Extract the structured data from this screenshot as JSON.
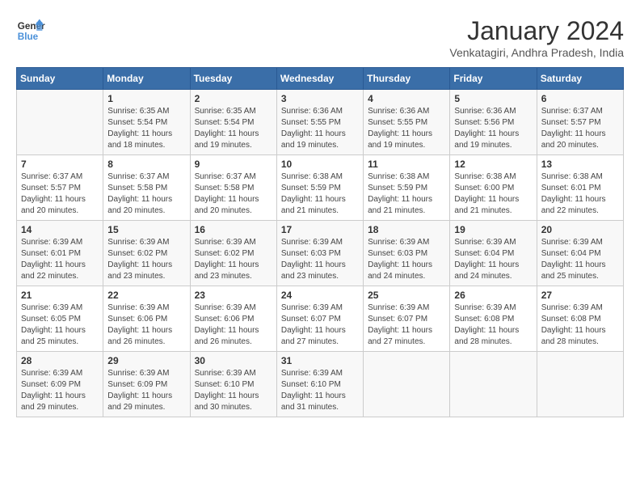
{
  "logo": {
    "line1": "General",
    "line2": "Blue"
  },
  "title": "January 2024",
  "subtitle": "Venkatagiri, Andhra Pradesh, India",
  "headers": [
    "Sunday",
    "Monday",
    "Tuesday",
    "Wednesday",
    "Thursday",
    "Friday",
    "Saturday"
  ],
  "weeks": [
    [
      {
        "day": "",
        "sunrise": "",
        "sunset": "",
        "daylight": ""
      },
      {
        "day": "1",
        "sunrise": "Sunrise: 6:35 AM",
        "sunset": "Sunset: 5:54 PM",
        "daylight": "Daylight: 11 hours and 18 minutes."
      },
      {
        "day": "2",
        "sunrise": "Sunrise: 6:35 AM",
        "sunset": "Sunset: 5:54 PM",
        "daylight": "Daylight: 11 hours and 19 minutes."
      },
      {
        "day": "3",
        "sunrise": "Sunrise: 6:36 AM",
        "sunset": "Sunset: 5:55 PM",
        "daylight": "Daylight: 11 hours and 19 minutes."
      },
      {
        "day": "4",
        "sunrise": "Sunrise: 6:36 AM",
        "sunset": "Sunset: 5:55 PM",
        "daylight": "Daylight: 11 hours and 19 minutes."
      },
      {
        "day": "5",
        "sunrise": "Sunrise: 6:36 AM",
        "sunset": "Sunset: 5:56 PM",
        "daylight": "Daylight: 11 hours and 19 minutes."
      },
      {
        "day": "6",
        "sunrise": "Sunrise: 6:37 AM",
        "sunset": "Sunset: 5:57 PM",
        "daylight": "Daylight: 11 hours and 20 minutes."
      }
    ],
    [
      {
        "day": "7",
        "sunrise": "Sunrise: 6:37 AM",
        "sunset": "Sunset: 5:57 PM",
        "daylight": "Daylight: 11 hours and 20 minutes."
      },
      {
        "day": "8",
        "sunrise": "Sunrise: 6:37 AM",
        "sunset": "Sunset: 5:58 PM",
        "daylight": "Daylight: 11 hours and 20 minutes."
      },
      {
        "day": "9",
        "sunrise": "Sunrise: 6:37 AM",
        "sunset": "Sunset: 5:58 PM",
        "daylight": "Daylight: 11 hours and 20 minutes."
      },
      {
        "day": "10",
        "sunrise": "Sunrise: 6:38 AM",
        "sunset": "Sunset: 5:59 PM",
        "daylight": "Daylight: 11 hours and 21 minutes."
      },
      {
        "day": "11",
        "sunrise": "Sunrise: 6:38 AM",
        "sunset": "Sunset: 5:59 PM",
        "daylight": "Daylight: 11 hours and 21 minutes."
      },
      {
        "day": "12",
        "sunrise": "Sunrise: 6:38 AM",
        "sunset": "Sunset: 6:00 PM",
        "daylight": "Daylight: 11 hours and 21 minutes."
      },
      {
        "day": "13",
        "sunrise": "Sunrise: 6:38 AM",
        "sunset": "Sunset: 6:01 PM",
        "daylight": "Daylight: 11 hours and 22 minutes."
      }
    ],
    [
      {
        "day": "14",
        "sunrise": "Sunrise: 6:39 AM",
        "sunset": "Sunset: 6:01 PM",
        "daylight": "Daylight: 11 hours and 22 minutes."
      },
      {
        "day": "15",
        "sunrise": "Sunrise: 6:39 AM",
        "sunset": "Sunset: 6:02 PM",
        "daylight": "Daylight: 11 hours and 23 minutes."
      },
      {
        "day": "16",
        "sunrise": "Sunrise: 6:39 AM",
        "sunset": "Sunset: 6:02 PM",
        "daylight": "Daylight: 11 hours and 23 minutes."
      },
      {
        "day": "17",
        "sunrise": "Sunrise: 6:39 AM",
        "sunset": "Sunset: 6:03 PM",
        "daylight": "Daylight: 11 hours and 23 minutes."
      },
      {
        "day": "18",
        "sunrise": "Sunrise: 6:39 AM",
        "sunset": "Sunset: 6:03 PM",
        "daylight": "Daylight: 11 hours and 24 minutes."
      },
      {
        "day": "19",
        "sunrise": "Sunrise: 6:39 AM",
        "sunset": "Sunset: 6:04 PM",
        "daylight": "Daylight: 11 hours and 24 minutes."
      },
      {
        "day": "20",
        "sunrise": "Sunrise: 6:39 AM",
        "sunset": "Sunset: 6:04 PM",
        "daylight": "Daylight: 11 hours and 25 minutes."
      }
    ],
    [
      {
        "day": "21",
        "sunrise": "Sunrise: 6:39 AM",
        "sunset": "Sunset: 6:05 PM",
        "daylight": "Daylight: 11 hours and 25 minutes."
      },
      {
        "day": "22",
        "sunrise": "Sunrise: 6:39 AM",
        "sunset": "Sunset: 6:06 PM",
        "daylight": "Daylight: 11 hours and 26 minutes."
      },
      {
        "day": "23",
        "sunrise": "Sunrise: 6:39 AM",
        "sunset": "Sunset: 6:06 PM",
        "daylight": "Daylight: 11 hours and 26 minutes."
      },
      {
        "day": "24",
        "sunrise": "Sunrise: 6:39 AM",
        "sunset": "Sunset: 6:07 PM",
        "daylight": "Daylight: 11 hours and 27 minutes."
      },
      {
        "day": "25",
        "sunrise": "Sunrise: 6:39 AM",
        "sunset": "Sunset: 6:07 PM",
        "daylight": "Daylight: 11 hours and 27 minutes."
      },
      {
        "day": "26",
        "sunrise": "Sunrise: 6:39 AM",
        "sunset": "Sunset: 6:08 PM",
        "daylight": "Daylight: 11 hours and 28 minutes."
      },
      {
        "day": "27",
        "sunrise": "Sunrise: 6:39 AM",
        "sunset": "Sunset: 6:08 PM",
        "daylight": "Daylight: 11 hours and 28 minutes."
      }
    ],
    [
      {
        "day": "28",
        "sunrise": "Sunrise: 6:39 AM",
        "sunset": "Sunset: 6:09 PM",
        "daylight": "Daylight: 11 hours and 29 minutes."
      },
      {
        "day": "29",
        "sunrise": "Sunrise: 6:39 AM",
        "sunset": "Sunset: 6:09 PM",
        "daylight": "Daylight: 11 hours and 29 minutes."
      },
      {
        "day": "30",
        "sunrise": "Sunrise: 6:39 AM",
        "sunset": "Sunset: 6:10 PM",
        "daylight": "Daylight: 11 hours and 30 minutes."
      },
      {
        "day": "31",
        "sunrise": "Sunrise: 6:39 AM",
        "sunset": "Sunset: 6:10 PM",
        "daylight": "Daylight: 11 hours and 31 minutes."
      },
      {
        "day": "",
        "sunrise": "",
        "sunset": "",
        "daylight": ""
      },
      {
        "day": "",
        "sunrise": "",
        "sunset": "",
        "daylight": ""
      },
      {
        "day": "",
        "sunrise": "",
        "sunset": "",
        "daylight": ""
      }
    ]
  ]
}
